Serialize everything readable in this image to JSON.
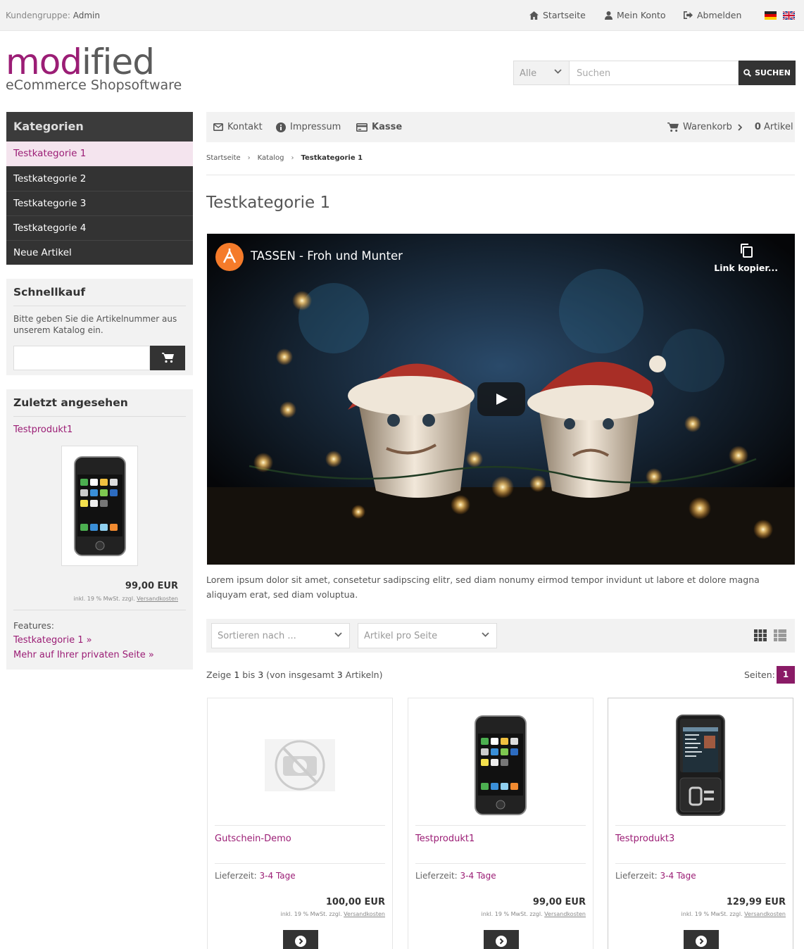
{
  "topbar": {
    "customer_group_label": "Kundengruppe:",
    "customer_group_value": "Admin",
    "nav": [
      "Startseite",
      "Mein Konto",
      "Abmelden"
    ],
    "languages": [
      "de",
      "en"
    ]
  },
  "logo": {
    "text_a": "mod",
    "text_b": "ified",
    "subtitle": "eCommerce Shopsoftware"
  },
  "search": {
    "category": "Alle",
    "placeholder": "Suchen",
    "button": "SUCHEN"
  },
  "categories": {
    "title": "Kategorien",
    "items": [
      "Testkategorie 1",
      "Testkategorie 2",
      "Testkategorie 3",
      "Testkategorie 4",
      "Neue Artikel"
    ]
  },
  "quickbuy": {
    "title": "Schnellkauf",
    "text": "Bitte geben Sie die Artikelnummer aus unserem Katalog ein."
  },
  "recent": {
    "title": "Zuletzt angesehen",
    "product": "Testprodukt1",
    "price": "99,00 EUR",
    "vat": "inkl. 19 % MwSt. zzgl.",
    "shipping": "Versandkosten",
    "features_label": "Features:",
    "links": [
      "Testkategorie 1 »",
      "Mehr auf Ihrer privaten Seite »"
    ]
  },
  "mainnav": {
    "contact": "Kontakt",
    "imprint": "Impressum",
    "checkout": "Kasse",
    "cart": "Warenkorb",
    "cart_count": "0",
    "cart_unit": "Artikel"
  },
  "breadcrumb": [
    "Startseite",
    "Katalog",
    "Testkategorie 1"
  ],
  "page_title": "Testkategorie 1",
  "video": {
    "title": "TASSEN - Froh und Munter",
    "copy": "Link kopier..."
  },
  "description": "Lorem ipsum dolor sit amet, consetetur sadipscing elitr, sed diam nonumy eirmod tempor invidunt ut labore et dolore magna aliquyam erat, sed diam voluptua.",
  "listing": {
    "sort_placeholder": "Sortieren nach ...",
    "per_page_placeholder": "Artikel pro Seite",
    "count_prefix": "Zeige",
    "count_from": "1",
    "count_mid": "bis",
    "count_to": "3",
    "count_suffix_a": "(von insgesamt",
    "count_total": "3",
    "count_suffix_b": "Artikeln)",
    "pages_label": "Seiten:",
    "current_page": "1"
  },
  "products": [
    {
      "name": "Gutschein-Demo",
      "delivery_label": "Lieferzeit:",
      "delivery": "3-4 Tage",
      "price": "100,00 EUR",
      "vat": "inkl. 19 % MwSt. zzgl.",
      "shipping": "Versandkosten"
    },
    {
      "name": "Testprodukt1",
      "delivery_label": "Lieferzeit:",
      "delivery": "3-4 Tage",
      "price": "99,00 EUR",
      "vat": "inkl. 19 % MwSt. zzgl.",
      "shipping": "Versandkosten"
    },
    {
      "name": "Testprodukt3",
      "delivery_label": "Lieferzeit:",
      "delivery": "3-4 Tage",
      "price": "129,99 EUR",
      "vat": "inkl. 19 % MwSt. zzgl.",
      "shipping": "Versandkosten"
    }
  ],
  "colors": {
    "brand": "#9b1d75",
    "dark": "#333333",
    "panel": "#f2f2f2"
  }
}
